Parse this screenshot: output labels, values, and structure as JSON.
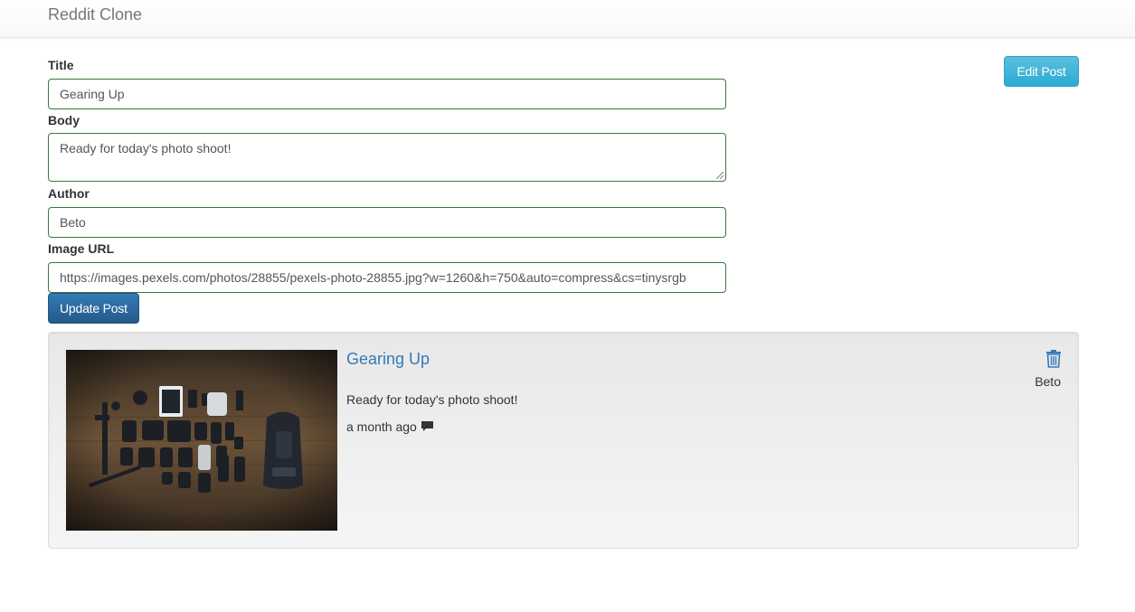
{
  "navbar": {
    "brand": "Reddit Clone"
  },
  "form": {
    "title_label": "Title",
    "title_value": "Gearing Up",
    "body_label": "Body",
    "body_value": "Ready for today's photo shoot!",
    "author_label": "Author",
    "author_value": "Beto",
    "image_url_label": "Image URL",
    "image_url_value": "https://images.pexels.com/photos/28855/pexels-photo-28855.jpg?w=1260&h=750&auto=compress&cs=tinysrgb",
    "submit_label": "Update Post"
  },
  "edit_button_label": "Edit Post",
  "post": {
    "title": "Gearing Up",
    "body": "Ready for today's photo shoot!",
    "timestamp": "a month ago",
    "author": "Beto",
    "comment_icon": "comment-icon",
    "delete_icon": "trash-icon",
    "image": "flat-lay of camera gear on wooden floor"
  },
  "colors": {
    "link": "#337ab7",
    "primary_button": "#265a88",
    "info_button": "#2aabd2",
    "input_border_success": "#3c763d"
  }
}
